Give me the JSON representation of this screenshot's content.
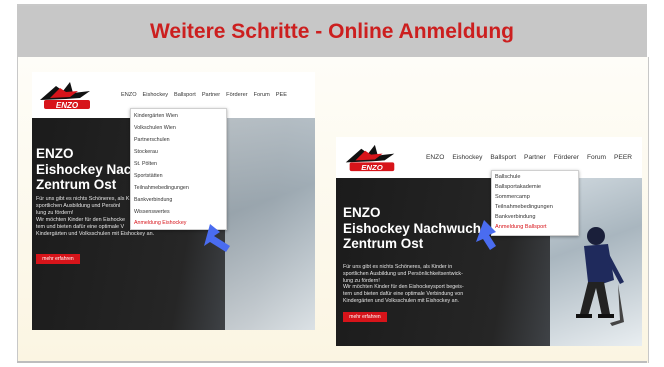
{
  "slide": {
    "title": "Weitere Schritte - Online Anmeldung",
    "title_color": "#cc1f1f",
    "header_bg": "#c7c7c7"
  },
  "screenshots": [
    {
      "logo_text": "ENZO",
      "nav_items": [
        "ENZO",
        "Eishockey",
        "Ballsport",
        "Partner",
        "Förderer",
        "Forum",
        "PEE"
      ],
      "hero_title_lines": [
        "ENZO",
        "Eishockey Nachwu",
        "Zentrum Ost"
      ],
      "hero_text_lines": [
        "Für uns gibt es nichts Schöneres, als K",
        "sportlichen Ausbildung und Persönl",
        "lung zu fördern!",
        "Wir möchten Kinder für den Eishocke",
        "tem und bieten dafür eine optimale V",
        "Kindergärten und Volksschulen mit Eishockey an."
      ],
      "button_label": "mehr erfahren",
      "dropdown_items": [
        "Kindergärten Wien",
        "Volkschulen Wien",
        "Partnerschulen",
        "Stockerau",
        "St. Pölten",
        "Sportstätten",
        "Teilnahmebedingungen",
        "Bankverbindung",
        "Wissenswertes",
        "Anmeldung Eishockey"
      ],
      "active_item": "Anmeldung Eishockey"
    },
    {
      "logo_text": "ENZO",
      "nav_items": [
        "ENZO",
        "Eishockey",
        "Ballsport",
        "Partner",
        "Förderer",
        "Forum",
        "PEER"
      ],
      "hero_title_lines": [
        "ENZO",
        "Eishockey Nachwuchs",
        "Zentrum Ost"
      ],
      "hero_text_lines": [
        "Für uns gibt es nichts Schöneres, als Kinder in",
        "sportlichen Ausbildung und Persönlichkeitsentwick-",
        "lung zu fördern!",
        "Wir möchten Kinder für den Eishockeysport begeis-",
        "tern und bieten dafür eine optimale Verbindung von",
        "Kindergärten und Volksschulen mit Eishockey an."
      ],
      "button_label": "mehr erfahren",
      "dropdown_items": [
        "Ballschule",
        "Ballsportakademie",
        "Sommercamp",
        "Teilnahmebedingungen",
        "Bankverbindung",
        "Anmeldung Ballsport"
      ],
      "active_item": "Anmeldung Ballsport"
    }
  ],
  "colors": {
    "accent_red": "#d7141a",
    "pointer_blue": "#4a6cf0"
  }
}
